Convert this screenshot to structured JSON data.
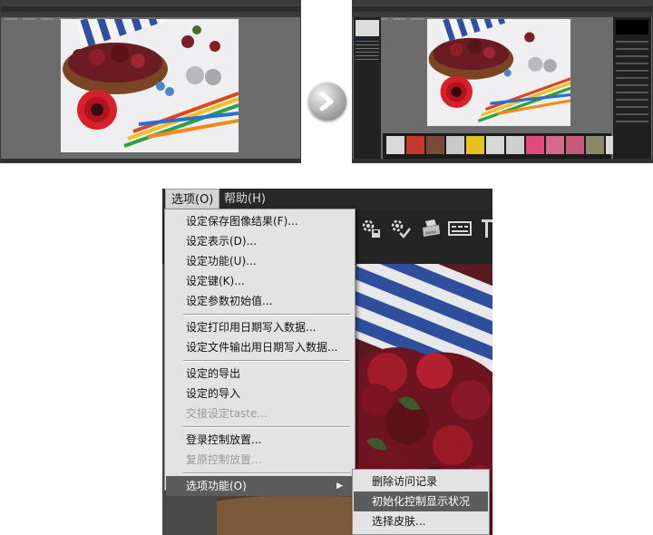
{
  "arrow": {
    "icon": "arrow-right-icon"
  },
  "menubar": {
    "items": [
      {
        "label": "选项(O)",
        "active": true
      },
      {
        "label": "帮助(H)",
        "active": false
      }
    ]
  },
  "toolbar": {
    "icons": [
      "settings-save-icon",
      "settings-check-icon",
      "printer-icon",
      "filmstrip-icon",
      "text-cursor-icon"
    ]
  },
  "options_menu": {
    "items": [
      {
        "label": "设定保存图像结果(F)...",
        "enabled": true
      },
      {
        "label": "设定表示(D)...",
        "enabled": true
      },
      {
        "label": "设定功能(U)...",
        "enabled": true
      },
      {
        "label": "设定键(K)...",
        "enabled": true
      },
      {
        "label": "设定参数初始值...",
        "enabled": true
      },
      {
        "separator": true
      },
      {
        "label": "设定打印用日期写入数据...",
        "enabled": true
      },
      {
        "label": "设定文件输出用日期写入数据...",
        "enabled": true
      },
      {
        "separator": true
      },
      {
        "label": "设定的导出",
        "enabled": true
      },
      {
        "label": "设定的导入",
        "enabled": true
      },
      {
        "label": "交接设定taste...",
        "enabled": false
      },
      {
        "separator": true
      },
      {
        "label": "登录控制放置...",
        "enabled": true
      },
      {
        "label": "复原控制放置...",
        "enabled": false
      },
      {
        "separator": true
      },
      {
        "label": "选项功能(O)",
        "enabled": true,
        "highlighted": true,
        "submenu": true
      }
    ]
  },
  "option_functions_submenu": {
    "items": [
      {
        "label": "删除访问记录",
        "highlighted": false
      },
      {
        "label": "初始化控制显示状况",
        "highlighted": true
      },
      {
        "label": "选择皮肤...",
        "highlighted": false
      }
    ]
  },
  "colors": {
    "menu_bg": "#e3e3e3",
    "highlight": "#5c5c5c",
    "app_bg": "#2a2a2a",
    "disabled_text": "#9a9a9a"
  }
}
